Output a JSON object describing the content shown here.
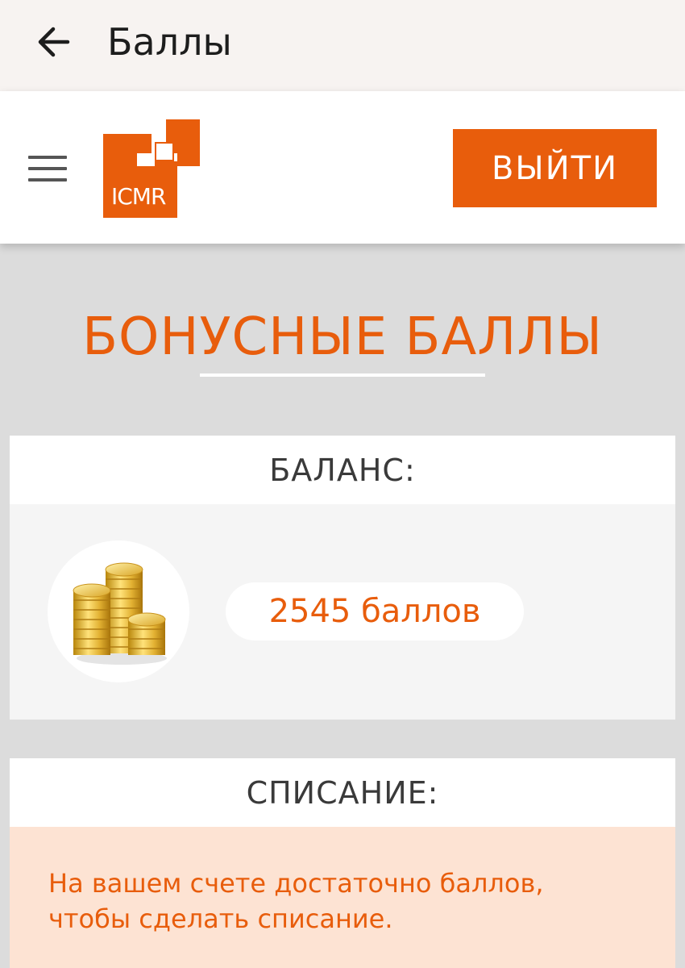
{
  "appbar": {
    "title": "Баллы",
    "back_icon": "arrow-left-icon"
  },
  "header": {
    "menu_icon": "hamburger-menu-icon",
    "logo_text": "ICMR",
    "logout_label": "ВЫЙТИ"
  },
  "page": {
    "title": "БОНУСНЫЕ БАЛЛЫ"
  },
  "balance": {
    "heading": "БАЛАНС:",
    "icon": "coin-stack-icon",
    "value": "2545 баллов"
  },
  "writeoff": {
    "heading": "СПИСАНИЕ:",
    "message": "На вашем счете достаточно баллов, чтобы сделать списание."
  },
  "colors": {
    "accent": "#e85d0c",
    "appbar_bg": "#f7f3f1",
    "page_bg": "#dcdcdc",
    "notice_bg": "#fde3d3"
  }
}
